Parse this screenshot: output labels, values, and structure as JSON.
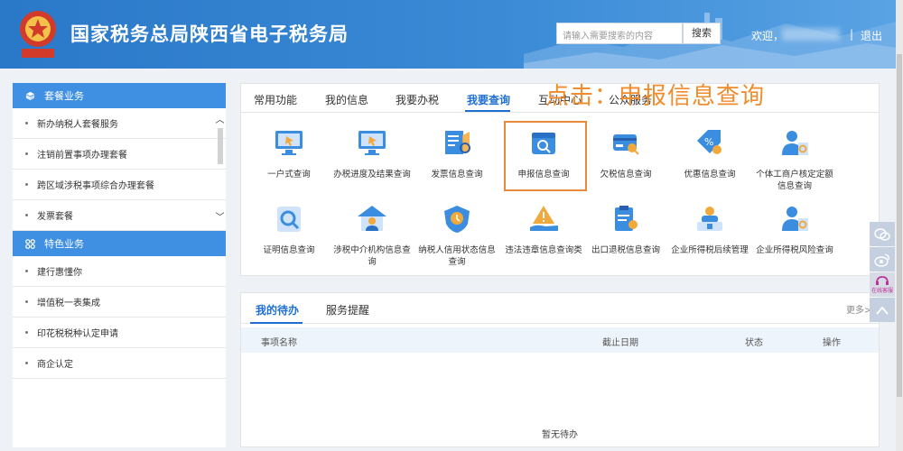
{
  "header": {
    "title": "国家税务总局陕西省电子税务局",
    "search_placeholder": "请输入需要搜索的内容",
    "search_button": "搜索",
    "welcome": "欢迎，",
    "separator": "|",
    "logout": "退出"
  },
  "sidebar": {
    "section1": {
      "title": "套餐业务",
      "icon": "cube-icon"
    },
    "section1_items": [
      "新办纳税人套餐服务",
      "注销前置事项办理套餐",
      "跨区域涉税事项综合办理套餐",
      "发票套餐"
    ],
    "section2": {
      "title": "特色业务",
      "icon": "grid-icon"
    },
    "section2_items": [
      "建行惠懂你",
      "增值税一表集成",
      "印花税税种认定申请",
      "商企认定"
    ]
  },
  "tabs": [
    "常用功能",
    "我的信息",
    "我要办税",
    "我要查询",
    "互动中心",
    "公众服务"
  ],
  "active_tab": "我要查询",
  "annotation": "点击：申报信息查询",
  "query_items": [
    {
      "label": "一户式查询",
      "icon": "monitor-cursor-icon"
    },
    {
      "label": "办税进度及结果查询",
      "icon": "monitor-progress-icon"
    },
    {
      "label": "发票信息查询",
      "icon": "invoice-search-icon"
    },
    {
      "label": "申报信息查询",
      "icon": "declaration-search-icon"
    },
    {
      "label": "欠税信息查询",
      "icon": "card-search-icon"
    },
    {
      "label": "优惠信息查询",
      "icon": "discount-search-icon"
    },
    {
      "label": "个体工商户核定定额信息查询",
      "icon": "person-search-icon"
    },
    {
      "label": "证明信息查询",
      "icon": "magnifier-icon"
    },
    {
      "label": "涉税中介机构信息查询",
      "icon": "agency-house-icon"
    },
    {
      "label": "纳税人信用状态信息查询",
      "icon": "credit-shield-icon"
    },
    {
      "label": "违法违章信息查询类",
      "icon": "warning-hand-icon"
    },
    {
      "label": "出口退税信息查询",
      "icon": "clipboard-search-icon"
    },
    {
      "label": "企业所得税后续管理",
      "icon": "enterprise-person-icon"
    },
    {
      "label": "企业所得税风险查询",
      "icon": "risk-person-icon"
    }
  ],
  "todo": {
    "tabs": [
      "我的待办",
      "服务提醒"
    ],
    "more": "更多>",
    "columns": [
      "事项名称",
      "截止日期",
      "状态",
      "操作"
    ],
    "empty": "暂无待办"
  },
  "float_bar": {
    "service_label": "在线客服"
  },
  "colors": {
    "primary": "#1e6fd0",
    "header": "#2a78c8",
    "highlight": "#e88a3c",
    "annotation": "#f08c2c"
  }
}
